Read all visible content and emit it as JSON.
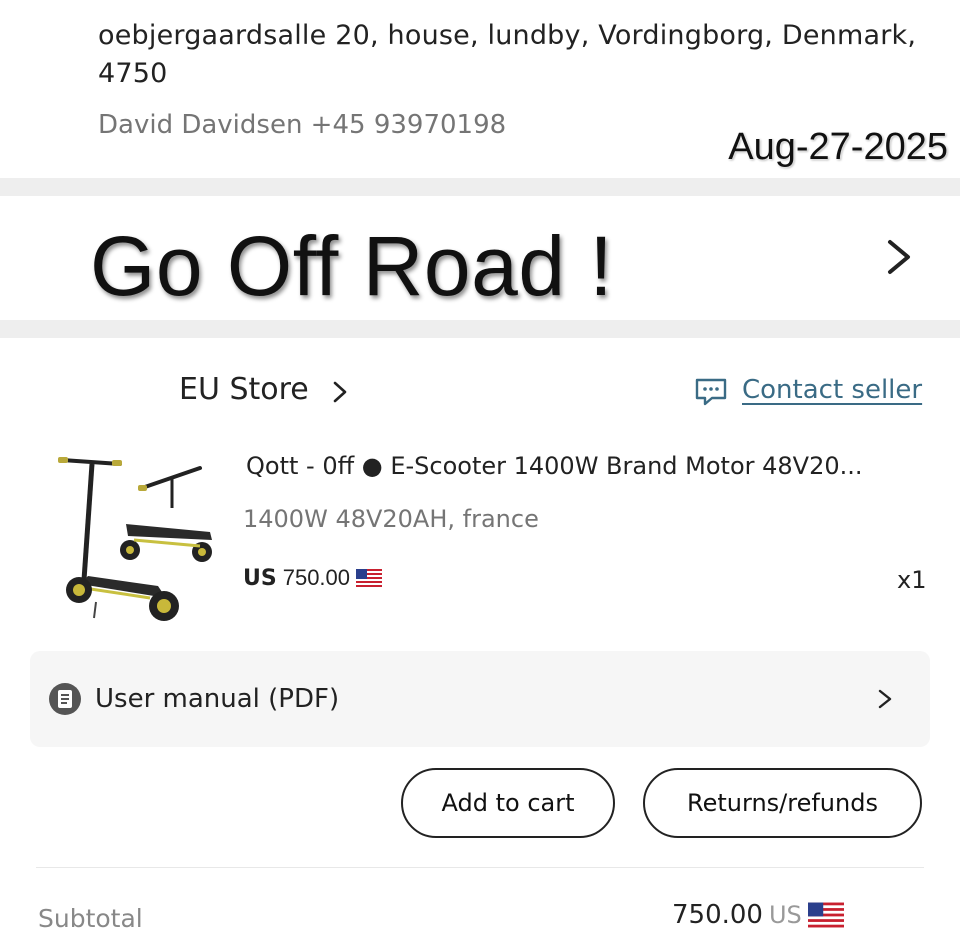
{
  "shipping": {
    "address_line1": "oebjergaardsalle 20, house, lundby, Vordingborg, Denmark,",
    "address_line2": "4750",
    "contact": "David Davidsen +45 93970198"
  },
  "date_stamp": "Aug-27-2025",
  "promo": {
    "text": "Go Off Road !",
    "chevron_icon": "chevron-right-icon"
  },
  "store": {
    "name": "EU Store",
    "chevron": "›",
    "contact_label": "Contact seller",
    "contact_icon": "chat-bubble-icon",
    "accent_color": "#3a6b85"
  },
  "product": {
    "title": "Qott - 0ff ● E-Scooter 1400W Brand Motor 48V20...",
    "variant": "1400W 48V20AH, france",
    "price_currency": "US",
    "price_value": "750.00",
    "flag_icon": "us-flag-icon",
    "quantity": "x1"
  },
  "manual": {
    "label": "User manual (PDF)",
    "icon": "document-icon"
  },
  "buttons": {
    "add_to_cart": "Add to cart",
    "returns": "Returns/refunds"
  },
  "summary": {
    "subtotal_label": "Subtotal",
    "subtotal_value": "750.00",
    "subtotal_currency": "US"
  }
}
